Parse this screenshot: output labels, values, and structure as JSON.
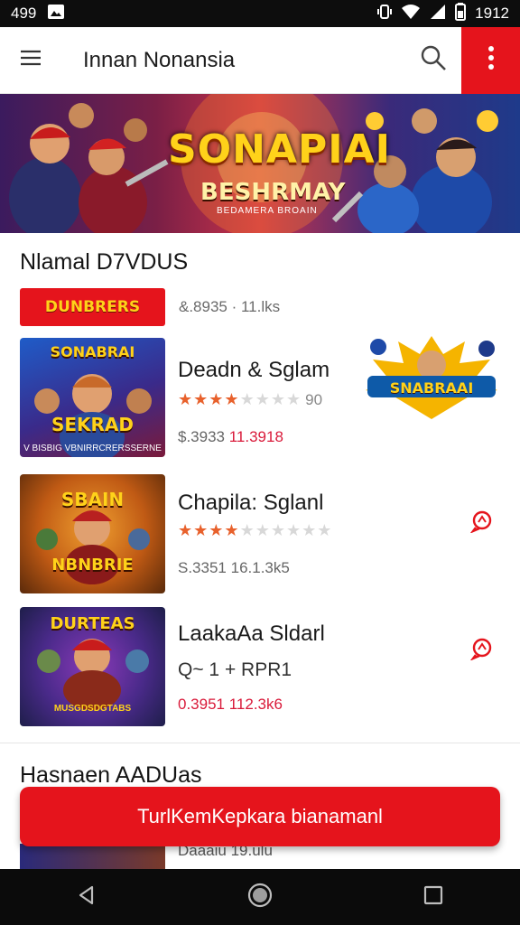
{
  "status_bar": {
    "time_left": "499",
    "time_right": "1912",
    "icons": [
      "image-icon",
      "vibrate-icon",
      "wifi-icon",
      "signal-icon",
      "battery-icon"
    ]
  },
  "app_bar": {
    "title": "Innan Nonansia",
    "icons": [
      "menu-icon",
      "search-icon",
      "more-vert-icon"
    ],
    "accent": "#e5141c"
  },
  "banner": {
    "headline": "SONAPIAI",
    "subline": "BESHRMAY",
    "fine_print": "BEDAMERA BROAIN"
  },
  "section1": {
    "title": "Nlamal D7VDUS",
    "badge_label": "DUNBRERS",
    "badge_meta": "&.8935 · 11.lks"
  },
  "games": [
    {
      "thumb_word": "SONABRAI",
      "thumb_word2": "SEKRAD",
      "thumb_caption": "V BISBIG VBNIRRCRERSSERNE",
      "name": "Deadn & Sglam",
      "stars_filled": 4,
      "stars_total": 8,
      "rating": "90",
      "meta_price": "$.3933",
      "meta_size": "11.3918",
      "side_logo": "SNABRAAI"
    },
    {
      "thumb_word": "SBAIN",
      "thumb_word2": "NBNBRIE",
      "thumb_caption": "",
      "name": "Chapila: Sglanl",
      "stars_filled": 4,
      "stars_total": 10,
      "meta_price": "S.3351",
      "meta_size": "16.1.3k5",
      "side_icon": "chat-alert-icon"
    },
    {
      "thumb_word": "DURTEAS",
      "thumb_word2": "",
      "thumb_caption": "MUSGDSDGTABS",
      "name": "LaakaAa Sldarl",
      "sub": "Q~ 1 + RPR1",
      "meta_price": "0.3951",
      "meta_size": "112.3k6",
      "side_icon": "chat-alert-icon"
    }
  ],
  "section2": {
    "title": "Hasnaen AADUas",
    "peek_text": "Daaaiu 19.ulu"
  },
  "cta": {
    "label": "TurlKemKepkara bianamanl"
  },
  "nav_bar": {
    "icons": [
      "back-icon",
      "home-icon",
      "recents-icon"
    ]
  }
}
